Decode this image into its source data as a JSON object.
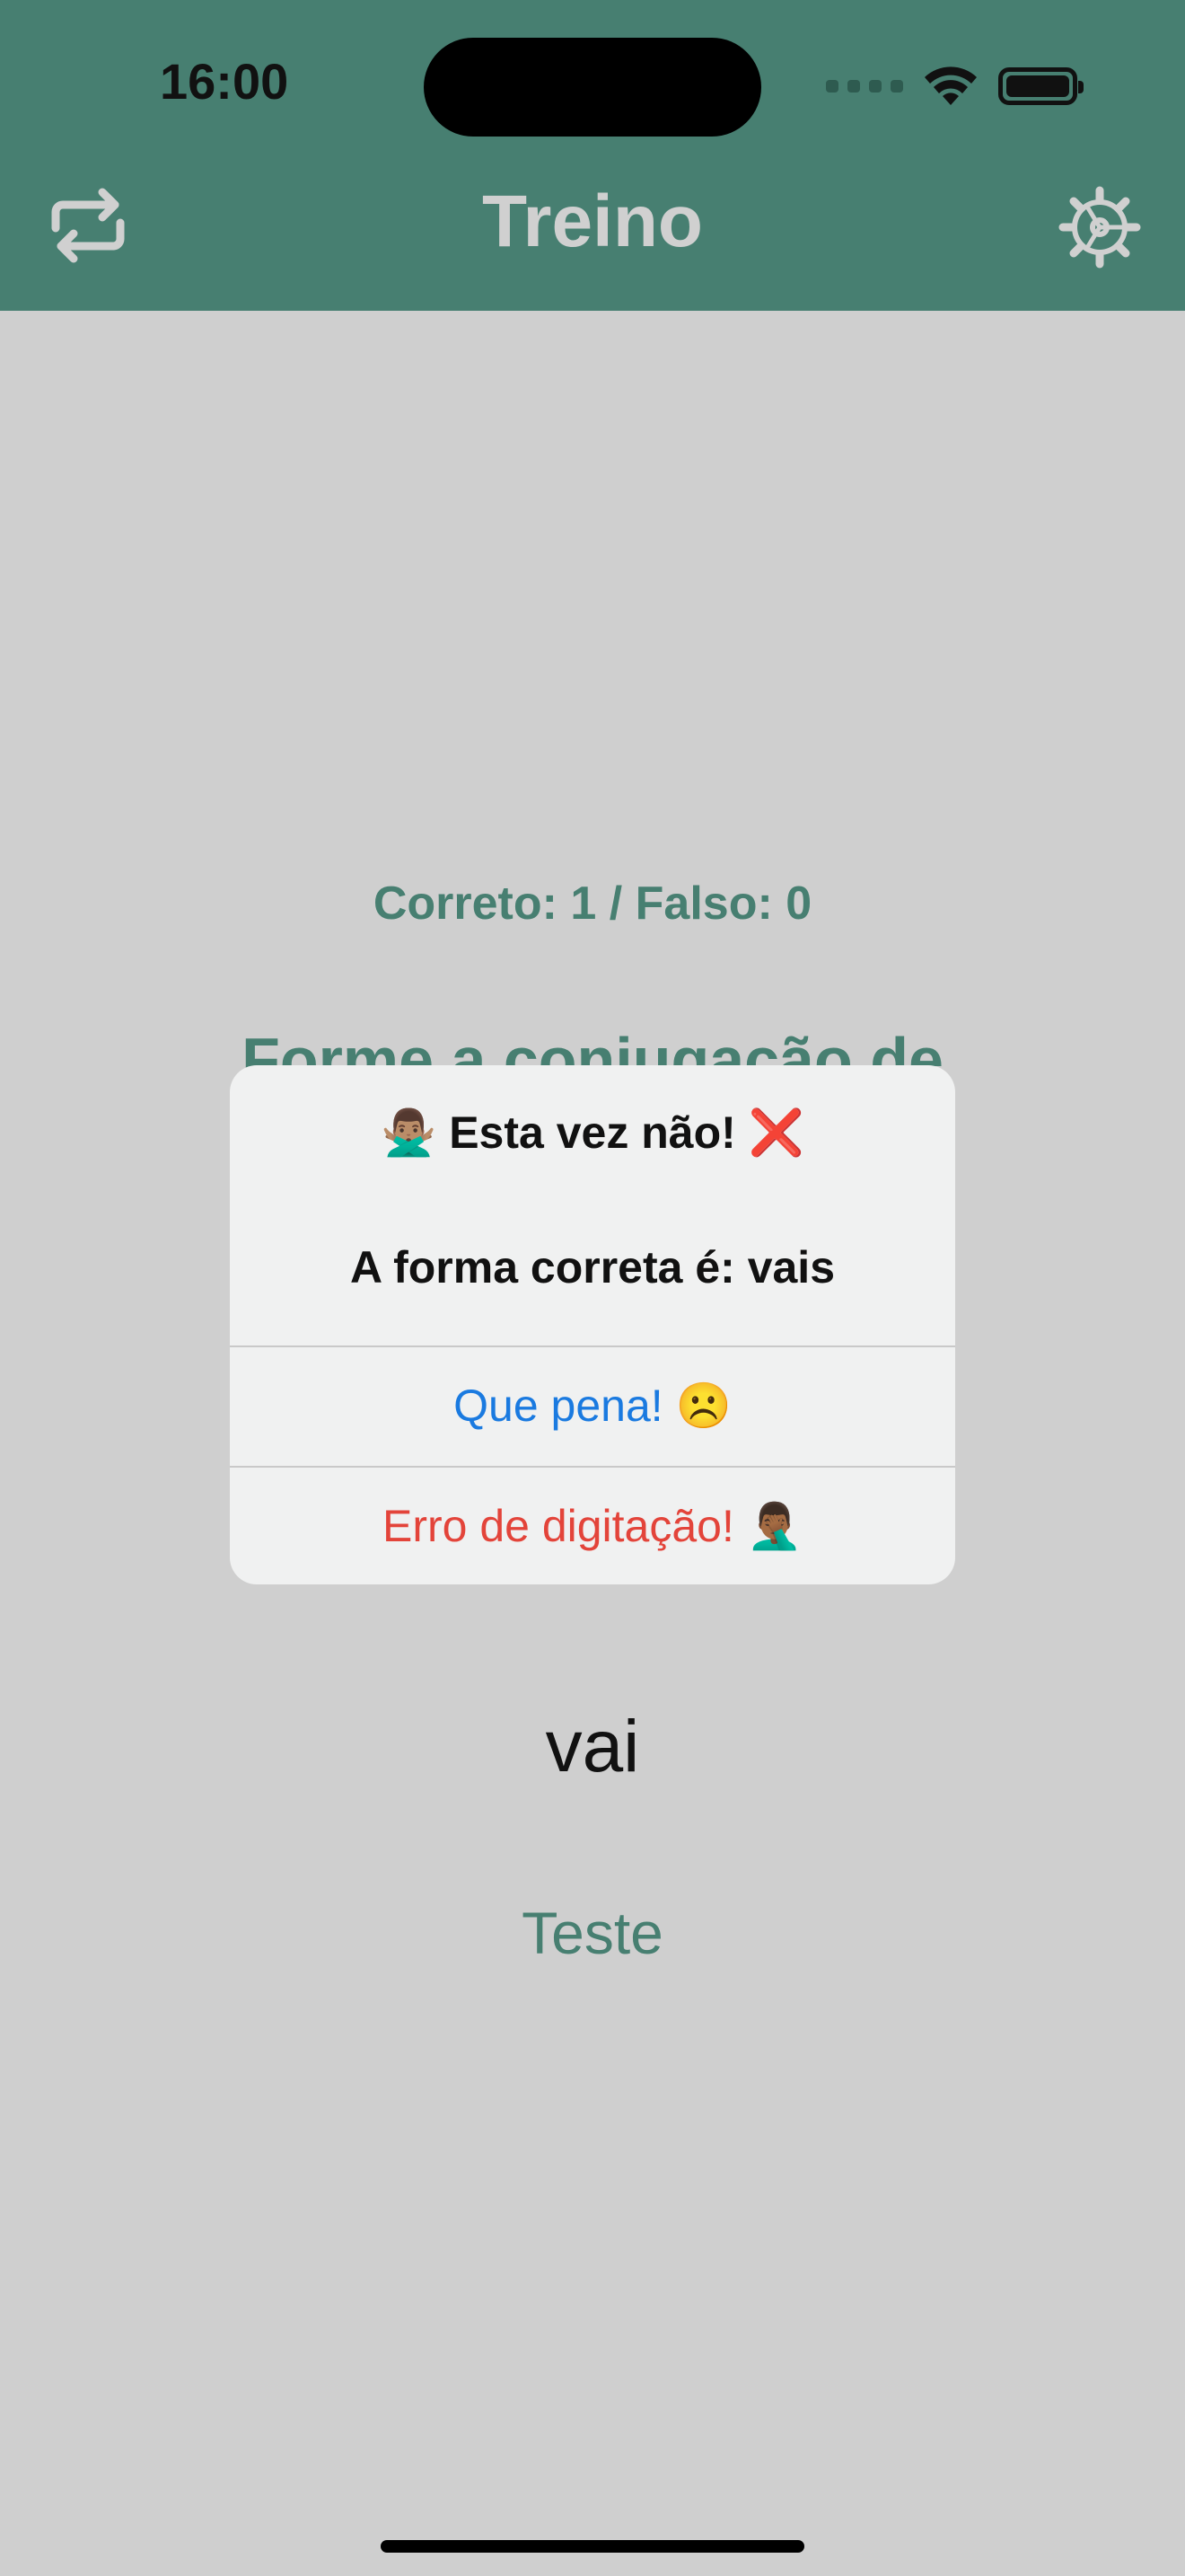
{
  "status": {
    "time": "16:00"
  },
  "header": {
    "title": "Treino"
  },
  "content": {
    "score": "Correto: 1 / Falso: 0",
    "prompt": "Forme a conjugação de",
    "answer": "vai",
    "test_button": "Teste"
  },
  "alert": {
    "title": "🙅🏽‍♂️ Esta vez não! ❌",
    "message": "A forma correta é: vais",
    "primary_button": "Que pena! ☹️",
    "destructive_button": "Erro de digitação! 🤦🏾‍♂️"
  },
  "colors": {
    "brand": "#477f71",
    "header_text": "#d0d0d0",
    "background": "#cfcfcf",
    "alert_bg": "#f0f1f1",
    "link_blue": "#1a7ae0",
    "destructive_red": "#e3443a"
  },
  "icons": [
    "refresh-icon",
    "settings-gear-icon",
    "wifi-icon",
    "battery-icon"
  ]
}
